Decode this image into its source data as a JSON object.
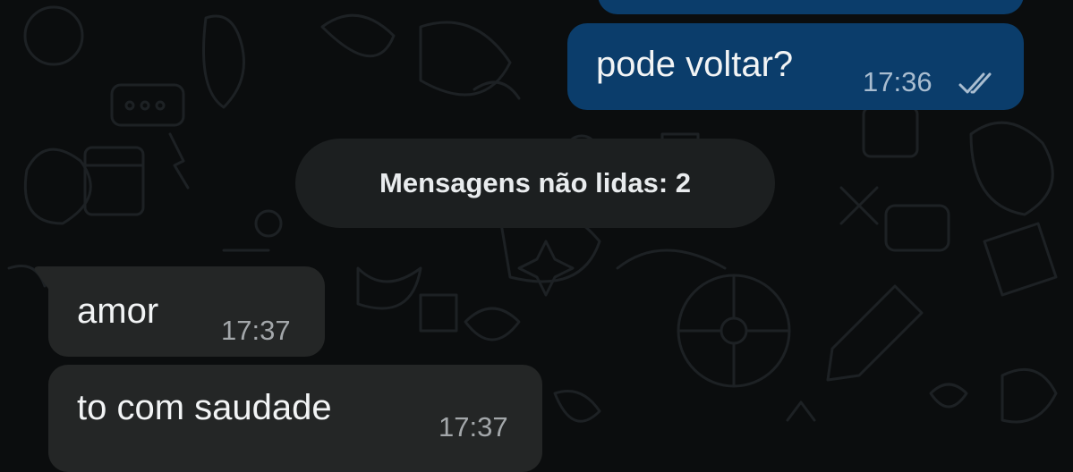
{
  "messages": [
    {
      "direction": "outgoing",
      "text": "pode voltar?",
      "time": "17:36",
      "status_icon": "double-check-icon"
    },
    {
      "direction": "incoming",
      "text": "amor",
      "time": "17:37"
    },
    {
      "direction": "incoming",
      "text": "to com saudade",
      "time": "17:37"
    }
  ],
  "unread_divider": {
    "label": "Mensagens não lidas: 2"
  },
  "colors": {
    "background": "#0b0d0e",
    "outgoing_bubble": "#0b3d6b",
    "incoming_bubble": "#242626",
    "divider_pill": "#1c1f20"
  }
}
